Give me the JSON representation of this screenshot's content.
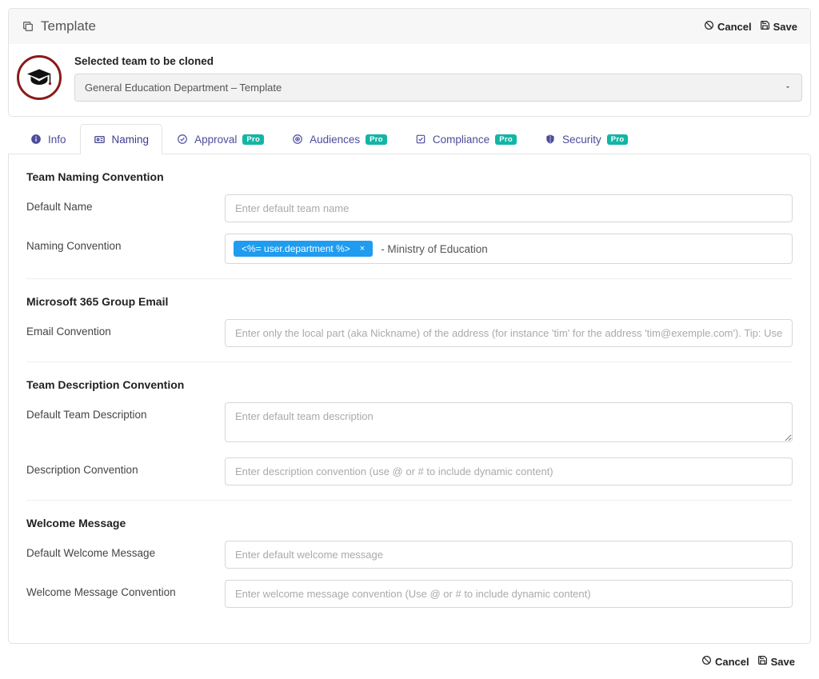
{
  "header": {
    "title": "Template",
    "cancel": "Cancel",
    "save": "Save"
  },
  "clone": {
    "label": "Selected team to be cloned",
    "selected": "General Education Department – Template"
  },
  "tabs": {
    "pro_label": "Pro",
    "info": "Info",
    "naming": "Naming",
    "approval": "Approval",
    "audiences": "Audiences",
    "compliance": "Compliance",
    "security": "Security"
  },
  "sections": {
    "team_naming": {
      "title": "Team Naming Convention",
      "default_name_label": "Default Name",
      "default_name_placeholder": "Enter default team name",
      "convention_label": "Naming Convention",
      "token_text": "<%= user.department %>",
      "suffix_text": " - Ministry of Education"
    },
    "group_email": {
      "title": "Microsoft 365 Group Email",
      "convention_label": "Email Convention",
      "convention_placeholder": "Enter only the local part (aka Nickname) of the address (for instance 'tim' for the address 'tim@exemple.com'). Tip: Use @ or # to include dynam"
    },
    "team_desc": {
      "title": "Team Description Convention",
      "default_label": "Default Team Description",
      "default_placeholder": "Enter default team description",
      "convention_label": "Description Convention",
      "convention_placeholder": "Enter description convention (use @ or # to include dynamic content)"
    },
    "welcome": {
      "title": "Welcome Message",
      "default_label": "Default Welcome Message",
      "default_placeholder": "Enter default welcome message",
      "convention_label": "Welcome Message Convention",
      "convention_placeholder": "Enter welcome message convention (Use @ or # to include dynamic content)"
    }
  },
  "footer": {
    "cancel": "Cancel",
    "save": "Save"
  }
}
